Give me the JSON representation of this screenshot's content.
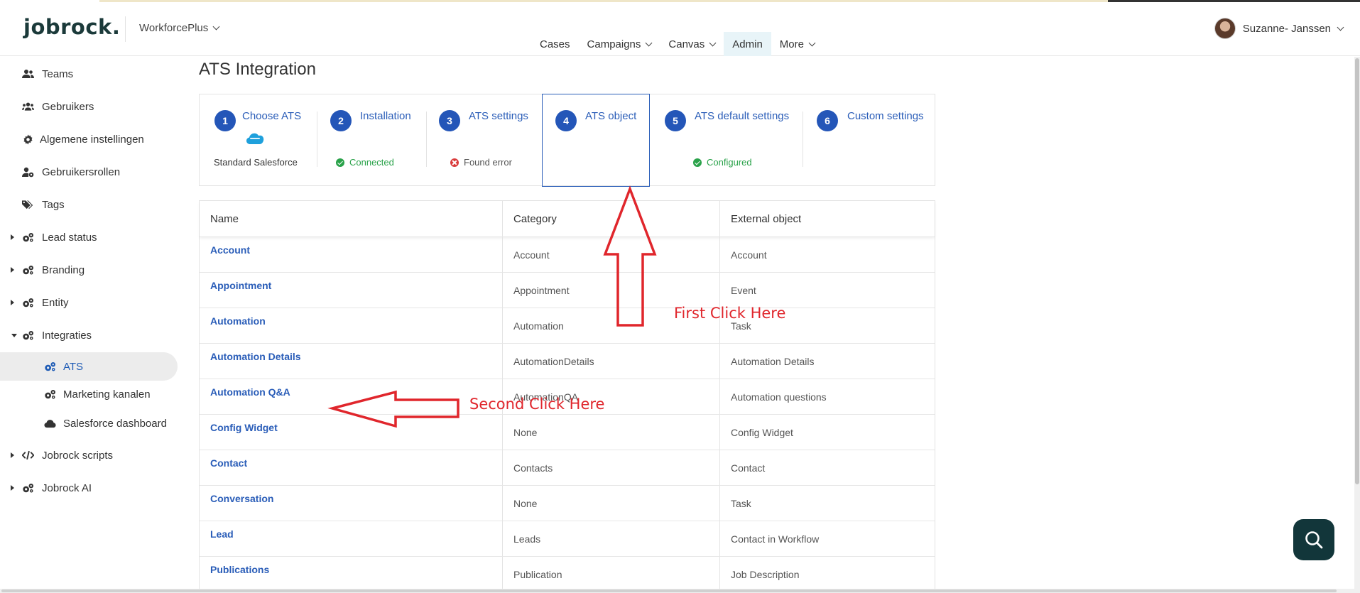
{
  "header": {
    "logo": "jobrock.",
    "workspace": "WorkforcePlus",
    "nav": [
      {
        "label": "Cases",
        "dropdown": false,
        "active": false
      },
      {
        "label": "Campaigns",
        "dropdown": true,
        "active": false
      },
      {
        "label": "Canvas",
        "dropdown": true,
        "active": false
      },
      {
        "label": "Admin",
        "dropdown": false,
        "active": true
      },
      {
        "label": "More",
        "dropdown": true,
        "active": false
      }
    ],
    "user_name": "Suzanne- Janssen"
  },
  "sidebar": {
    "items": [
      {
        "label": "Teams",
        "icon": "users-icon"
      },
      {
        "label": "Gebruikers",
        "icon": "users-group-icon"
      },
      {
        "label": "Algemene instellingen",
        "icon": "gear-icon"
      },
      {
        "label": "Gebruikersrollen",
        "icon": "user-gear-icon"
      },
      {
        "label": "Tags",
        "icon": "tags-icon"
      },
      {
        "label": "Lead status",
        "icon": "gears-icon"
      },
      {
        "label": "Branding",
        "icon": "gears-icon"
      },
      {
        "label": "Entity",
        "icon": "gears-icon"
      },
      {
        "label": "Integraties",
        "icon": "gears-icon"
      },
      {
        "label": "ATS",
        "icon": "gears-icon"
      },
      {
        "label": "Marketing kanalen",
        "icon": "gears-icon"
      },
      {
        "label": "Salesforce dashboard",
        "icon": "cloud-icon"
      },
      {
        "label": "Jobrock scripts",
        "icon": "code-icon"
      },
      {
        "label": "Jobrock AI",
        "icon": "gears-icon"
      }
    ]
  },
  "main": {
    "title": "ATS Integration",
    "steps": [
      {
        "num": "1",
        "title": "Choose ATS",
        "status": "Standard Salesforce",
        "state": "plain"
      },
      {
        "num": "2",
        "title": "Installation",
        "status": "Connected",
        "state": "ok"
      },
      {
        "num": "3",
        "title": "ATS settings",
        "status": "Found error",
        "state": "err"
      },
      {
        "num": "4",
        "title": "ATS object",
        "status": "",
        "state": "current"
      },
      {
        "num": "5",
        "title": "ATS default settings",
        "status": "Configured",
        "state": "ok"
      },
      {
        "num": "6",
        "title": "Custom settings",
        "status": "",
        "state": "none"
      }
    ],
    "table": {
      "headers": [
        "Name",
        "Category",
        "External object"
      ],
      "rows": [
        [
          "Account",
          "Account",
          "Account"
        ],
        [
          "Appointment",
          "Appointment",
          "Event"
        ],
        [
          "Automation",
          "Automation",
          "Task"
        ],
        [
          "Automation Details",
          "AutomationDetails",
          "Automation Details"
        ],
        [
          "Automation Q&A",
          "AutomationQA",
          "Automation questions"
        ],
        [
          "Config Widget",
          "None",
          "Config Widget"
        ],
        [
          "Contact",
          "Contacts",
          "Contact"
        ],
        [
          "Conversation",
          "None",
          "Task"
        ],
        [
          "Lead",
          "Leads",
          "Contact in Workflow"
        ],
        [
          "Publications",
          "Publication",
          "Job Description"
        ]
      ]
    }
  },
  "annotations": {
    "first": "First Click Here",
    "second": "Second Click Here"
  },
  "colors": {
    "accent": "#2456b8",
    "link": "#2a5db8",
    "ok": "#2aa24a",
    "error": "#d93a3a",
    "annotation": "#e0262c",
    "fab": "#12363a"
  }
}
